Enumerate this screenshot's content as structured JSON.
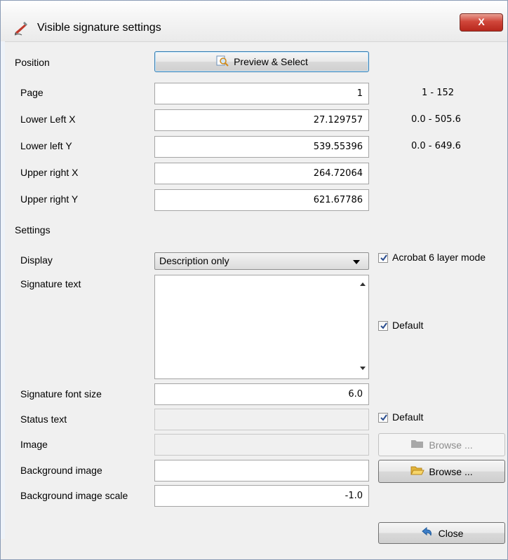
{
  "window": {
    "title": "Visible signature settings",
    "close_glyph": "X",
    "title_icon": "signature-pen-icon"
  },
  "position": {
    "section_label": "Position",
    "preview_button": "Preview & Select",
    "rows": [
      {
        "label": "Page",
        "value": "1",
        "range": "1 - 152"
      },
      {
        "label": "Lower Left X",
        "value": "27.129757",
        "range": "0.0 - 505.6"
      },
      {
        "label": "Lower left Y",
        "value": "539.55396",
        "range": "0.0 - 649.6"
      },
      {
        "label": "Upper right X",
        "value": "264.72064",
        "range": ""
      },
      {
        "label": "Upper right Y",
        "value": "621.67786",
        "range": ""
      }
    ]
  },
  "settings": {
    "section_label": "Settings",
    "display_label": "Display",
    "display_value": "Description only",
    "acrobat_checkbox_label": "Acrobat 6 layer mode",
    "acrobat_checked": true,
    "signature_text_label": "Signature text",
    "signature_text_value": "",
    "signature_default_label": "Default",
    "signature_default_checked": true,
    "font_size_label": "Signature font size",
    "font_size_value": "6.0",
    "status_text_label": "Status text",
    "status_text_value": "",
    "status_default_label": "Default",
    "status_default_checked": true,
    "image_label": "Image",
    "image_value": "",
    "image_browse": "Browse ...",
    "bg_image_label": "Background image",
    "bg_image_value": "",
    "bg_browse": "Browse ...",
    "bg_scale_label": "Background image scale",
    "bg_scale_value": "-1.0",
    "close_button": "Close"
  },
  "colors": {
    "close_red": "#c8372b",
    "window_bg": "#f0f0f0"
  }
}
